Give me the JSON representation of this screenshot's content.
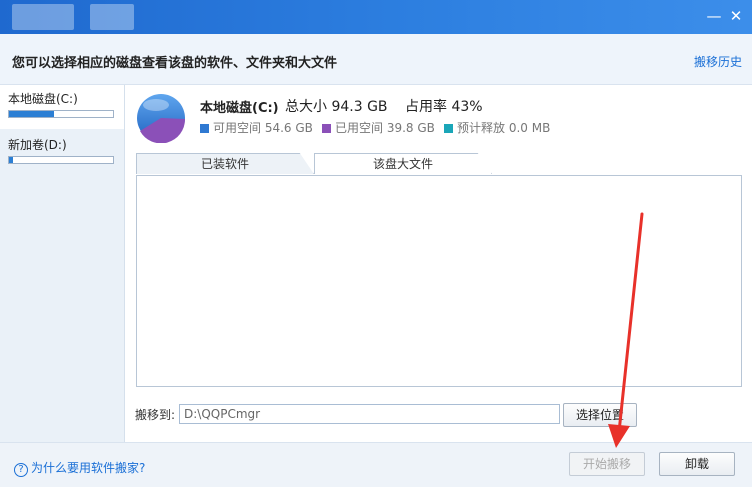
{
  "window": {
    "minimize_glyph": "—",
    "close_glyph": "✕"
  },
  "header": {
    "prompt": "您可以选择相应的磁盘查看该盘的软件、文件夹和大文件",
    "history_link": "搬移历史"
  },
  "drives": [
    {
      "label": "本地磁盘(C:)",
      "usage_fraction": 0.43
    },
    {
      "label": "新加卷(D:)",
      "usage_fraction": 0.04
    }
  ],
  "disk": {
    "name": "本地磁盘(C:)",
    "total": "总大小 94.3 GB",
    "usage": "占用率 43%",
    "free_label": "可用空间 54.6 GB",
    "used_label": "已用空间 39.8 GB",
    "release_label": "预计释放 0.0 MB",
    "colors": {
      "free": "#2f79d2",
      "used": "#8b50b8",
      "release": "#1aa6b8"
    }
  },
  "tabs": [
    "已装软件",
    "该盘大文件"
  ],
  "move": {
    "label": "搬移到:",
    "path_value": "D:\\QQPCmgr",
    "choose_button": "选择位置"
  },
  "footer": {
    "help_link": "为什么要用软件搬家?",
    "start_button": "开始搬移",
    "uninstall_button": "卸载"
  }
}
